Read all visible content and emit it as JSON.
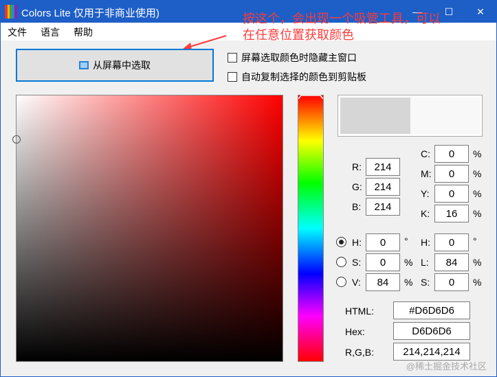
{
  "titlebar": {
    "title": "Colors Lite 仅用于非商业使用)",
    "annotation": "按这个，会出现一个吸管工具，可以在任意位置获取颜色",
    "min": "—",
    "max": "☐",
    "close": "✕"
  },
  "menu": {
    "file": "文件",
    "lang": "语言",
    "help": "帮助"
  },
  "pick_button": {
    "label": "从屏幕中选取"
  },
  "options": {
    "hide_window": "屏幕选取颜色时隐藏主窗口",
    "auto_copy": "自动复制选择的颜色到剪贴板"
  },
  "colors": {
    "current": "#D6D6D6",
    "accent": "#1e5ec7",
    "annotation": "#ff3b3b"
  },
  "rgb": {
    "r_label": "R:",
    "r": "214",
    "g_label": "G:",
    "g": "214",
    "b_label": "B:",
    "b": "214"
  },
  "cmyk": {
    "c_label": "C:",
    "c": "0",
    "m_label": "M:",
    "m": "0",
    "y_label": "Y:",
    "y": "0",
    "k_label": "K:",
    "k": "16",
    "unit": "%"
  },
  "hsv": {
    "h_label": "H:",
    "h": "0",
    "h_unit": "°",
    "s_label": "S:",
    "s": "0",
    "s_unit": "%",
    "v_label": "V:",
    "v": "84",
    "v_unit": "%"
  },
  "hsl": {
    "h_label": "H:",
    "h": "0",
    "h_unit": "°",
    "l_label": "L:",
    "l": "84",
    "l_unit": "%",
    "s_label": "S:",
    "s": "0",
    "s_unit": "%"
  },
  "codes": {
    "html_label": "HTML:",
    "html": "#D6D6D6",
    "hex_label": "Hex:",
    "hex": "D6D6D6",
    "rgb_label": "R,G,B:",
    "rgb": "214,214,214"
  },
  "watermark": "@稀土掘金技术社区"
}
